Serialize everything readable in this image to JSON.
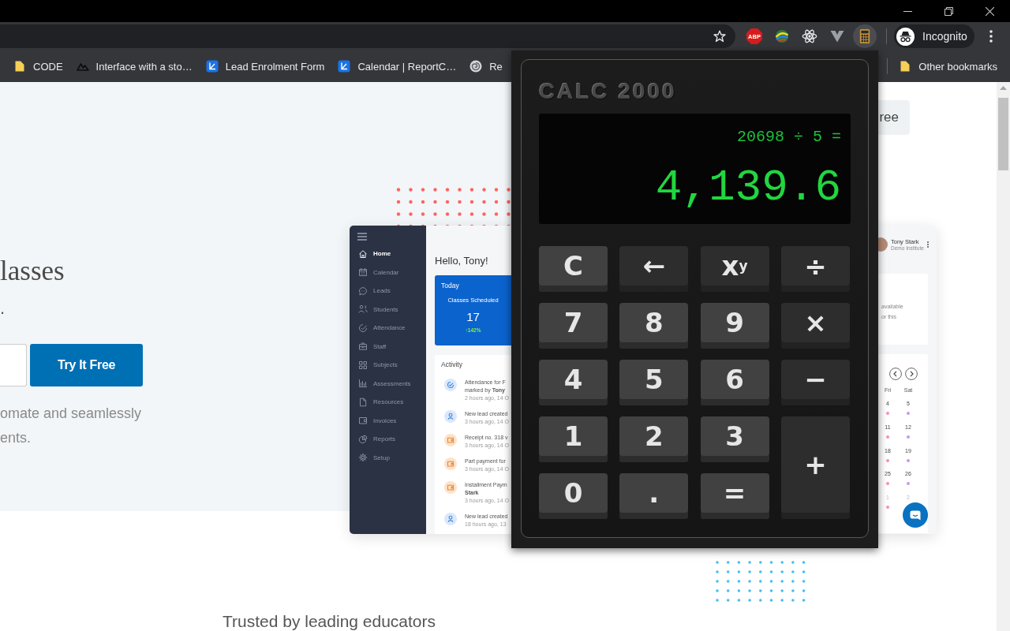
{
  "toolbar": {
    "extensions": [
      {
        "kind": "abp",
        "label": "ABP",
        "selected": false
      },
      {
        "kind": "globe",
        "selected": false
      },
      {
        "kind": "atom",
        "selected": false
      },
      {
        "kind": "vee",
        "selected": false
      },
      {
        "kind": "calculator",
        "selected": true
      }
    ],
    "profile": "Incognito"
  },
  "bookmarks": {
    "items": [
      {
        "kind": "folder",
        "label": "CODE"
      },
      {
        "kind": "mountain",
        "label": "Interface with a sto…"
      },
      {
        "kind": "app",
        "label": "Lead Enrolment Form"
      },
      {
        "kind": "app",
        "label": "Calendar | ReportC…"
      },
      {
        "kind": "swirl",
        "label": "Re"
      }
    ],
    "other": {
      "kind": "folder",
      "label": "Other bookmarks"
    }
  },
  "page": {
    "header_button": "ree",
    "heading": "lasses",
    "subheading": ".",
    "cta_button": "Try It Free",
    "body_lines": [
      "omate and seamlessly",
      "ents."
    ],
    "section_heading": "Trusted by leading educators"
  },
  "dashboard": {
    "sidebar": [
      {
        "kind": "home",
        "label": "Home",
        "selected": true
      },
      {
        "kind": "calendar",
        "label": "Calendar",
        "selected": false
      },
      {
        "kind": "leads",
        "label": "Leads",
        "selected": false
      },
      {
        "kind": "students",
        "label": "Students",
        "selected": false
      },
      {
        "kind": "attendance",
        "label": "Attendance",
        "selected": false
      },
      {
        "kind": "staff",
        "label": "Staff",
        "selected": false
      },
      {
        "kind": "subjects",
        "label": "Subjects",
        "selected": false
      },
      {
        "kind": "assessments",
        "label": "Assessments",
        "selected": false
      },
      {
        "kind": "resources",
        "label": "Resources",
        "selected": false
      },
      {
        "kind": "invoices",
        "label": "Invoices",
        "selected": false
      },
      {
        "kind": "reports",
        "label": "Reports",
        "selected": false
      },
      {
        "kind": "setup",
        "label": "Setup",
        "selected": false
      }
    ],
    "greeting": "Hello, Tony!",
    "today_card": {
      "title": "Today",
      "label": "Classes Scheduled",
      "value": "17",
      "change": "↑142%"
    },
    "activity": {
      "title": "Activity",
      "items": [
        {
          "kind": "attendance",
          "lines": [
            "Attendance for F",
            "marked by **Tony**"
          ],
          "time": "2 hours ago, 14 O"
        },
        {
          "kind": "lead",
          "lines": [
            "New lead created"
          ],
          "time": "3 hours ago, 14 O"
        },
        {
          "kind": "payment",
          "lines": [
            "Receipt no. 318 v"
          ],
          "time": "3 hours ago, 14 O"
        },
        {
          "kind": "payment",
          "lines": [
            "Part payment for"
          ],
          "time": "3 hours ago, 14 O"
        },
        {
          "kind": "payment",
          "lines": [
            "Installment Paym",
            "**Stark**"
          ],
          "time": "3 hours ago, 14 O"
        },
        {
          "kind": "lead",
          "lines": [
            "New lead created"
          ],
          "time": "18 hours ago, 13"
        }
      ]
    },
    "user": {
      "name": "Tony Stark",
      "org": "Demo Institute"
    },
    "notice_lines": [
      "available",
      "or this"
    ],
    "calendar": {
      "weekdays": [
        "Fri",
        "Sat"
      ],
      "weeks": [
        [
          {
            "date": "4",
            "muted": false,
            "color": "#f48fc0"
          },
          {
            "date": "5",
            "muted": false,
            "color": "#c39af0"
          }
        ],
        [
          {
            "date": "11",
            "muted": false,
            "color": "#f48fc0"
          },
          {
            "date": "12",
            "muted": false,
            "color": "#c39af0"
          }
        ],
        [
          {
            "date": "18",
            "muted": false,
            "color": "#f48fc0"
          },
          {
            "date": "19",
            "muted": false,
            "color": "#c39af0"
          }
        ],
        [
          {
            "date": "25",
            "muted": false,
            "color": "#f48fc0"
          },
          {
            "date": "26",
            "muted": false,
            "color": "#c39af0"
          }
        ],
        [
          {
            "date": "1",
            "muted": true,
            "color": "#f48fc0"
          },
          {
            "date": "2",
            "muted": true
          }
        ]
      ]
    }
  },
  "calculator": {
    "logo": "CALC 2000",
    "expression": "20698 ÷ 5 =",
    "result": "4,139.6",
    "keys": [
      {
        "label": "C",
        "kind": "clear"
      },
      {
        "label": "←",
        "kind": "operator"
      },
      {
        "label": "x$^{y}$",
        "kind": "operator"
      },
      {
        "label": "÷",
        "kind": "operator"
      },
      {
        "label": "7",
        "kind": "digit"
      },
      {
        "label": "8",
        "kind": "digit"
      },
      {
        "label": "9",
        "kind": "digit"
      },
      {
        "label": "×",
        "kind": "operator"
      },
      {
        "label": "4",
        "kind": "digit"
      },
      {
        "label": "5",
        "kind": "digit"
      },
      {
        "label": "6",
        "kind": "digit"
      },
      {
        "label": "−",
        "kind": "operator"
      },
      {
        "label": "1",
        "kind": "digit"
      },
      {
        "label": "2",
        "kind": "digit"
      },
      {
        "label": "3",
        "kind": "digit"
      },
      {
        "label": "+",
        "kind": "tall"
      },
      {
        "label": "0",
        "kind": "digit"
      },
      {
        "label": ".",
        "kind": "digit"
      },
      {
        "label": "=",
        "kind": "equals"
      }
    ]
  }
}
